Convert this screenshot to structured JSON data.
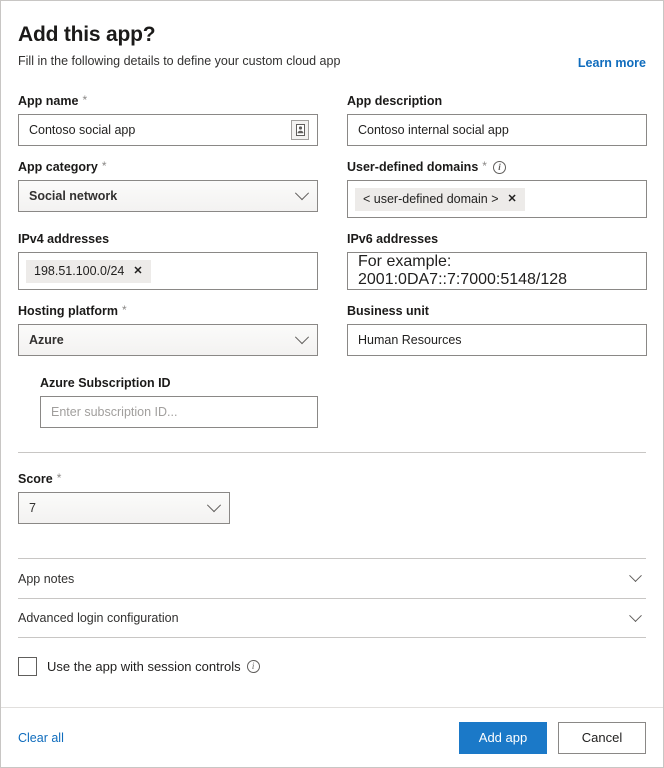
{
  "header": {
    "title": "Add this app?",
    "subtitle": "Fill in the following details to define your custom cloud app",
    "learn_more": "Learn more"
  },
  "form": {
    "app_name": {
      "label": "App name",
      "required": "*",
      "value": "Contoso social app",
      "icon": "contact-card-icon"
    },
    "app_description": {
      "label": "App description",
      "value": "Contoso internal social app"
    },
    "app_category": {
      "label": "App category",
      "required": "*",
      "value": "Social network"
    },
    "user_defined_domains": {
      "label": "User-defined domains",
      "required": "*",
      "info": "i",
      "chips": [
        "< user-defined domain >"
      ],
      "chip_remove": "✕"
    },
    "ipv4_addresses": {
      "label": "IPv4 addresses",
      "chips": [
        "198.51.100.0/24"
      ],
      "chip_remove": "✕"
    },
    "ipv6_addresses": {
      "label": "IPv6 addresses",
      "placeholder": "For example: 2001:0DA7::7:7000:5148/128",
      "value": ""
    },
    "hosting_platform": {
      "label": "Hosting platform",
      "required": "*",
      "value": "Azure"
    },
    "business_unit": {
      "label": "Business unit",
      "value": "Human Resources"
    },
    "azure_subscription_id": {
      "label": "Azure Subscription ID",
      "placeholder": "Enter subscription ID...",
      "value": ""
    },
    "score": {
      "label": "Score",
      "required": "*",
      "value": "7"
    }
  },
  "sections": [
    {
      "title": "App notes"
    },
    {
      "title": "Advanced login configuration"
    }
  ],
  "session_controls": {
    "label": "Use the app with session controls",
    "info": "i",
    "checked": false
  },
  "footer": {
    "clear_all": "Clear all",
    "primary": "Add app",
    "secondary": "Cancel"
  },
  "colors": {
    "accent": "#1b79c8",
    "link": "#0f6cbd",
    "border": "#8a8886",
    "chip_bg": "#edebe9"
  }
}
